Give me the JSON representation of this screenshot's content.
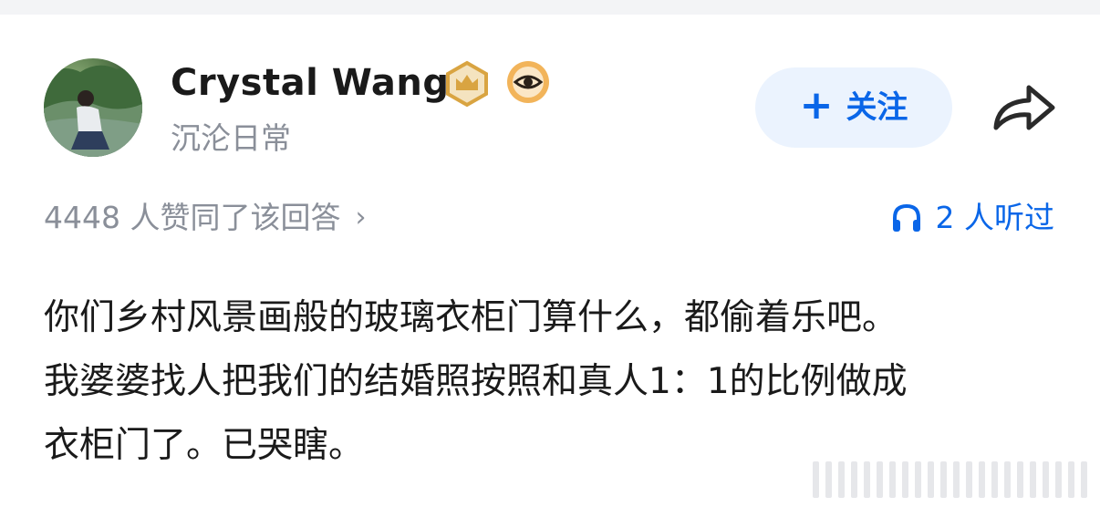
{
  "author": {
    "name": "Crystal Wang",
    "subtitle": "沉沦日常",
    "crown_badge_icon": "crown-badge-icon",
    "eye_badge_icon": "eye-badge-icon",
    "badge_color": "#d9a441"
  },
  "actions": {
    "follow_plus": "+",
    "follow_label": "关注",
    "share_icon": "share-arrow-icon",
    "accent_color": "#0a66e8"
  },
  "stats": {
    "votes_text": "4448 人赞同了该回答",
    "votes_chevron": "›",
    "listens_text": "2 人听过",
    "listens_icon": "headphones-icon"
  },
  "answer": {
    "lines": [
      "你们乡村风景画般的玻璃衣柜门算什么，都偷着乐吧。",
      "我婆婆找人把我们的结婚照按照和真人1：1的比例做成",
      "衣柜门了。已哭瞎。"
    ]
  }
}
